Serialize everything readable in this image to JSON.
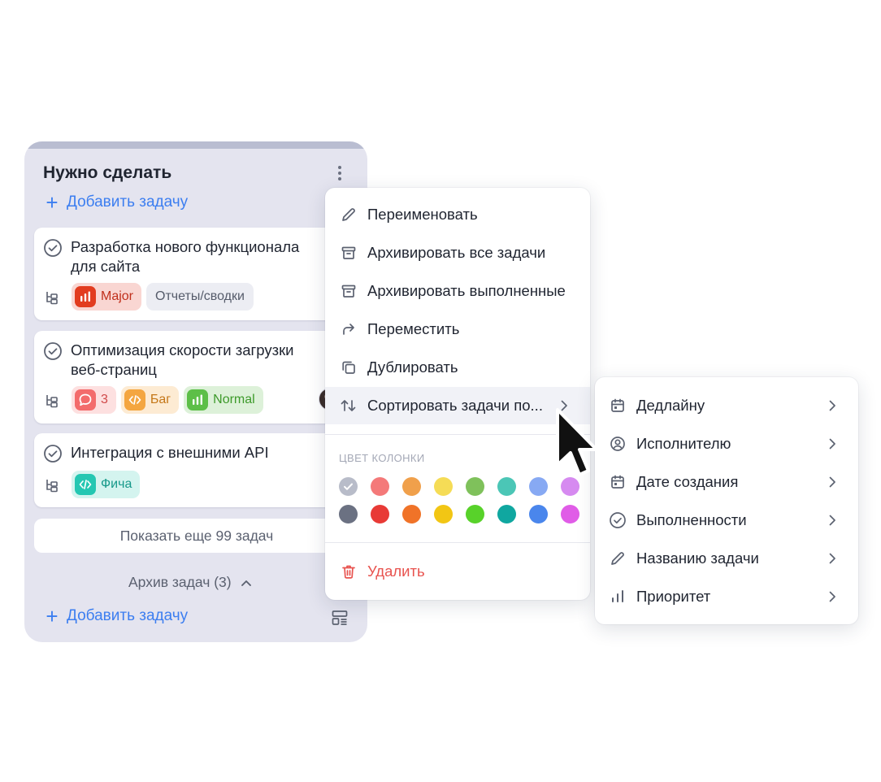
{
  "column": {
    "title": "Нужно сделать",
    "add_task_label": "Добавить задачу",
    "cards": [
      {
        "title": "Разработка нового функционала для сайта",
        "tags": [
          {
            "label": "Major",
            "icon": "bar-chart-icon",
            "bg": "#f9d6d2",
            "icon_bg": "#e23c1f",
            "color": "#c0301c"
          },
          {
            "label": "Отчеты/сводки",
            "plain": true
          }
        ]
      },
      {
        "title": "Оптимизация скорости загрузки веб-страниц",
        "tags": [
          {
            "label": "3",
            "icon": "comment-icon",
            "bg": "#fde0e0",
            "icon_bg": "#f36c6c",
            "color": "#d04a4a"
          },
          {
            "label": "Баг",
            "icon": "code-icon",
            "bg": "#fdebd3",
            "icon_bg": "#f4a640",
            "color": "#c57718"
          },
          {
            "label": "Normal",
            "icon": "bar-chart-icon",
            "bg": "#ddf1d9",
            "icon_bg": "#5dbf48",
            "color": "#3d9a2a"
          }
        ]
      },
      {
        "title": "Интеграция с внешними API",
        "tags": [
          {
            "label": "Фича",
            "icon": "code-icon",
            "bg": "#d4f4ef",
            "icon_bg": "#24c7b2",
            "color": "#16998a"
          }
        ]
      }
    ],
    "show_more_label": "Показать еще 99 задач",
    "archive_label": "Архив задач (3)",
    "add_task_bottom_label": "Добавить задачу"
  },
  "menu": {
    "items": [
      {
        "label": "Переименовать",
        "icon": "pencil-icon"
      },
      {
        "label": "Архивировать все задачи",
        "icon": "archive-icon"
      },
      {
        "label": "Архивировать выполненные",
        "icon": "archive-icon"
      },
      {
        "label": "Переместить",
        "icon": "move-arrow-icon"
      },
      {
        "label": "Дублировать",
        "icon": "duplicate-icon"
      },
      {
        "label": "Сортировать задачи по...",
        "icon": "sort-icon"
      }
    ],
    "color_caption": "ЦВЕТ КОЛОНКИ",
    "colors_light": [
      "#b8bcc9",
      "#f47979",
      "#f0a04b",
      "#f5dc56",
      "#7fc15b",
      "#4bc6b6",
      "#87a9f3",
      "#d68af0"
    ],
    "colors_dark": [
      "#6b7182",
      "#e83a36",
      "#f07328",
      "#f2c614",
      "#58d22a",
      "#10a7a0",
      "#4a86ec",
      "#e05ce7"
    ],
    "selected_color": "#b8bcc9",
    "delete_label": "Удалить"
  },
  "submenu": {
    "items": [
      {
        "label": "Дедлайну",
        "icon": "calendar-icon"
      },
      {
        "label": "Исполнителю",
        "icon": "user-circle-icon"
      },
      {
        "label": "Дате создания",
        "icon": "calendar-icon"
      },
      {
        "label": "Выполненности",
        "icon": "check-circle-icon"
      },
      {
        "label": "Названию задачи",
        "icon": "pencil-icon"
      },
      {
        "label": "Приоритет",
        "icon": "bar-chart-icon"
      }
    ]
  }
}
